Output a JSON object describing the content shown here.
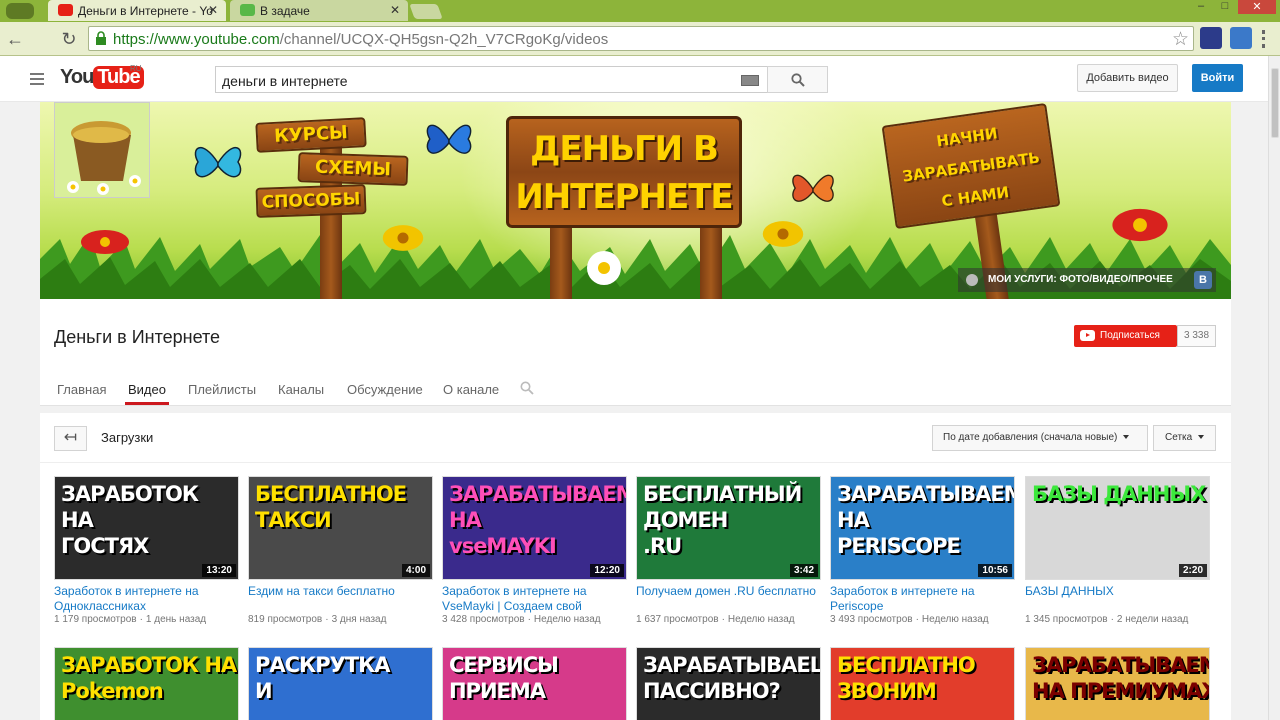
{
  "browser": {
    "tabs": [
      {
        "title": "Деньги в Интернете - Yo",
        "active": true
      },
      {
        "title": "В задаче",
        "active": false
      }
    ],
    "url_host": "https://www.youtube.com",
    "url_path": "/channel/UCQX-QH5gsn-Q2h_V7CRgoKg/videos",
    "window_minimize": "–",
    "window_maximize": "□",
    "window_close": "✕"
  },
  "header": {
    "logo_you": "You",
    "logo_tube": "Tube",
    "logo_region": "RU",
    "search_query": "деньги в интернете",
    "add_video": "Добавить видео",
    "login": "Войти"
  },
  "banner": {
    "sign_left": [
      "КУРСЫ",
      "СХЕМЫ",
      "СПОСОБЫ"
    ],
    "sign_center": [
      "ДЕНЬГИ В",
      "ИНТЕРНЕТЕ"
    ],
    "sign_right": [
      "НАЧНИ",
      "ЗАРАБАТЫВАТЬ",
      "С НАМИ"
    ],
    "services_link": "МОИ УСЛУГИ: ФОТО/ВИДЕО/ПРОЧЕЕ",
    "vk_letter": "В"
  },
  "channel": {
    "name": "Деньги в Интернете",
    "subscribe": "Подписаться",
    "subscribers": "3 338",
    "tabs": [
      "Главная",
      "Видео",
      "Плейлисты",
      "Каналы",
      "Обсуждение",
      "О канале"
    ],
    "active_tab": "Видео"
  },
  "content": {
    "section_title": "Загрузки",
    "sort": "По дате добавления (сначала новые)",
    "view": "Сетка",
    "back_icon": "↤"
  },
  "videos": [
    {
      "thumb_text": [
        "ЗАРАБОТОК",
        "НА",
        "ГОСТЯХ"
      ],
      "duration": "13:20",
      "title": "Заработок в интернете на Одноклассниках",
      "views": "1 179 просмотров",
      "age": "1 день назад",
      "bg": "#2b2b2b",
      "fg": "#ffffff"
    },
    {
      "thumb_text": [
        "БЕСПЛАТНОЕ",
        "ТАКСИ"
      ],
      "duration": "4:00",
      "title": "Ездим на такси бесплатно",
      "views": "819 просмотров",
      "age": "3 дня назад",
      "bg": "#4a4a4a",
      "fg": "#ffe000"
    },
    {
      "thumb_text": [
        "ЗАРАБАТЫВАЕМ",
        "НА",
        "vseMAYKI"
      ],
      "duration": "12:20",
      "title": "Заработок в интернете на VseMayki | Создаем свой",
      "views": "3 428 просмотров",
      "age": "Неделю назад",
      "bg": "#3a2a8c",
      "fg": "#ff4fb8"
    },
    {
      "thumb_text": [
        "БЕСПЛАТНЫЙ",
        "ДОМЕН",
        ".RU"
      ],
      "duration": "3:42",
      "title": "Получаем домен .RU бесплатно",
      "views": "1 637 просмотров",
      "age": "Неделю назад",
      "bg": "#1f7a3a",
      "fg": "#ffffff"
    },
    {
      "thumb_text": [
        "ЗАРАБАТЫВАЕМ",
        "НА",
        "PERISCOPE"
      ],
      "duration": "10:56",
      "title": "Заработок в интернете на Periscope",
      "views": "3 493 просмотров",
      "age": "Неделю назад",
      "bg": "#2a7fc8",
      "fg": "#ffffff"
    },
    {
      "thumb_text": [
        "БАЗЫ ДАННЫХ"
      ],
      "duration": "2:20",
      "title": "БАЗЫ ДАННЫХ",
      "views": "1 345 просмотров",
      "age": "2 недели назад",
      "bg": "#d8d8d8",
      "fg": "#3ce83c"
    },
    {
      "thumb_text": [
        "ЗАРАБОТОК НА",
        "Pokemon"
      ],
      "duration": "",
      "title": "",
      "views": "",
      "age": "",
      "bg": "#3f8f2f",
      "fg": "#ffe000"
    },
    {
      "thumb_text": [
        "РАСКРУТКА",
        "И"
      ],
      "duration": "",
      "title": "",
      "views": "",
      "age": "",
      "bg": "#2f6fd0",
      "fg": "#ffffff"
    },
    {
      "thumb_text": [
        "СЕРВИСЫ",
        "ПРИЕМА"
      ],
      "duration": "",
      "title": "",
      "views": "",
      "age": "",
      "bg": "#d63a8a",
      "fg": "#ffffff"
    },
    {
      "thumb_text": [
        "ЗАРАБАТЫВАЕШЬ",
        "ПАССИВНО?"
      ],
      "duration": "",
      "title": "",
      "views": "",
      "age": "",
      "bg": "#2b2b2b",
      "fg": "#ffffff"
    },
    {
      "thumb_text": [
        "БЕСПЛАТНО",
        "ЗВОНИМ"
      ],
      "duration": "",
      "title": "",
      "views": "",
      "age": "",
      "bg": "#e23d2b",
      "fg": "#ffe000"
    },
    {
      "thumb_text": [
        "ЗАРАБАТЫВАЕМ",
        "НА ПРЕМИУМАХ"
      ],
      "duration": "",
      "title": "",
      "views": "",
      "age": "",
      "bg": "#e8b84a",
      "fg": "#7a0000"
    }
  ]
}
